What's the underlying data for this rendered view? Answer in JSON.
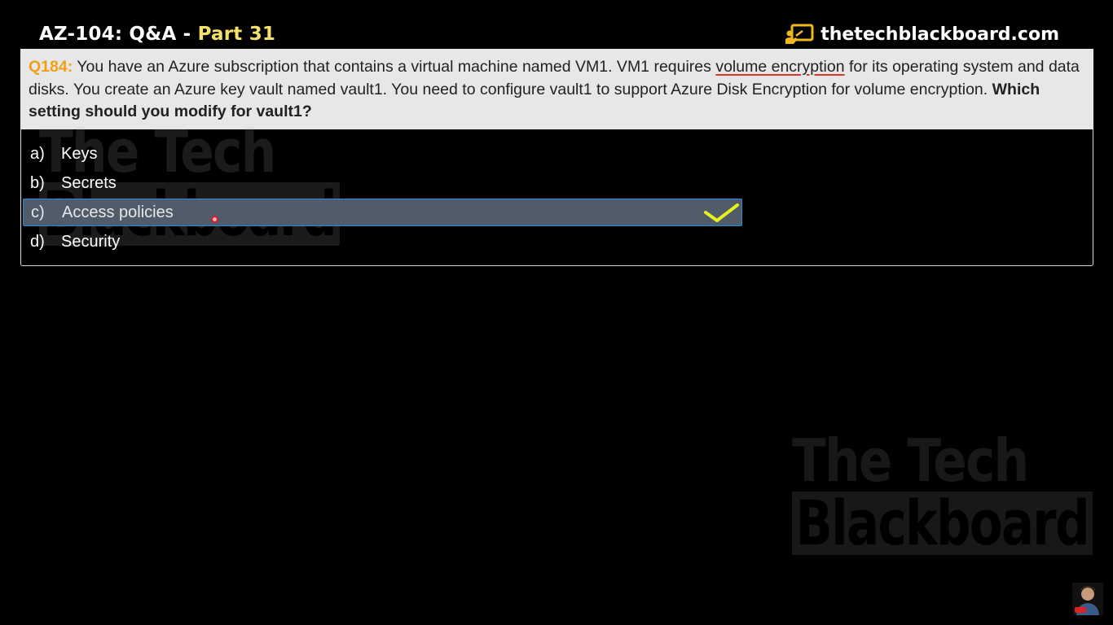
{
  "header": {
    "title_main": "AZ-104: Q&A - ",
    "title_part": "Part 31",
    "brand": "thetechblackboard.com"
  },
  "question": {
    "number": "Q184:",
    "text_before": " You have an Azure subscription that contains a virtual machine named VM1. VM1 requires ",
    "text_underlined": "volume encryption",
    "text_after": " for its operating system and data disks. You create an Azure key vault named vault1. You need to configure vault1 to support Azure Disk Encryption for volume encryption. ",
    "text_bold": "Which setting should you modify for vault1?"
  },
  "options": [
    {
      "letter": "a)",
      "label": "Keys",
      "selected": false
    },
    {
      "letter": "b)",
      "label": "Secrets",
      "selected": false
    },
    {
      "letter": "c)",
      "label": "Access policies",
      "selected": true
    },
    {
      "letter": "d)",
      "label": "Security",
      "selected": false
    }
  ],
  "watermark": {
    "line1": "The Tech",
    "line2": "Blackboard"
  },
  "icons": {
    "brand": "chalkboard-presenter-icon",
    "correct": "checkmark-icon",
    "cursor": "mouse-cursor-dot",
    "avatar": "presenter-avatar"
  },
  "colors": {
    "part_accent": "#f5e06a",
    "question_number": "#f0a11a",
    "selected_bg": "#505c6a",
    "selected_border": "#2e8bd8",
    "checkmark": "#e6f21c",
    "underline": "#e0342b"
  }
}
